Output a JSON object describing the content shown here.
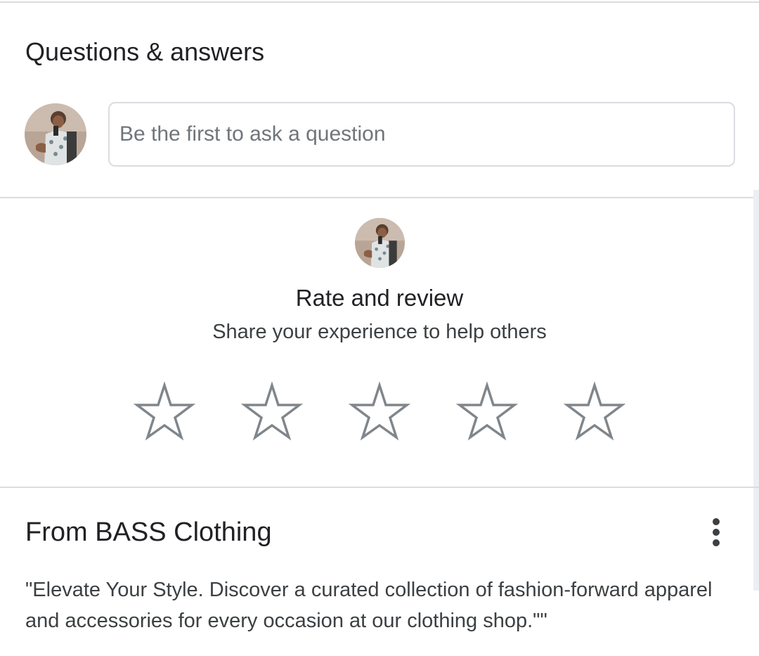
{
  "questions_answers": {
    "title": "Questions & answers",
    "input_placeholder": "Be the first to ask a question"
  },
  "rate_review": {
    "title": "Rate and review",
    "subtitle": "Share your experience to help others",
    "star_count": 5,
    "selected_rating": 0,
    "star_icon": "star-outline-icon"
  },
  "merchant": {
    "title": "From BASS Clothing",
    "description": "\"Elevate Your Style. Discover a curated collection of fashion-forward apparel and accessories for every occasion at our clothing shop.\"\"",
    "menu_icon": "more-vert-icon"
  },
  "colors": {
    "text_primary": "#202124",
    "text_secondary": "#3c4043",
    "divider": "#dadce0",
    "star_outline": "#80868b",
    "icon": "#3c4043"
  }
}
